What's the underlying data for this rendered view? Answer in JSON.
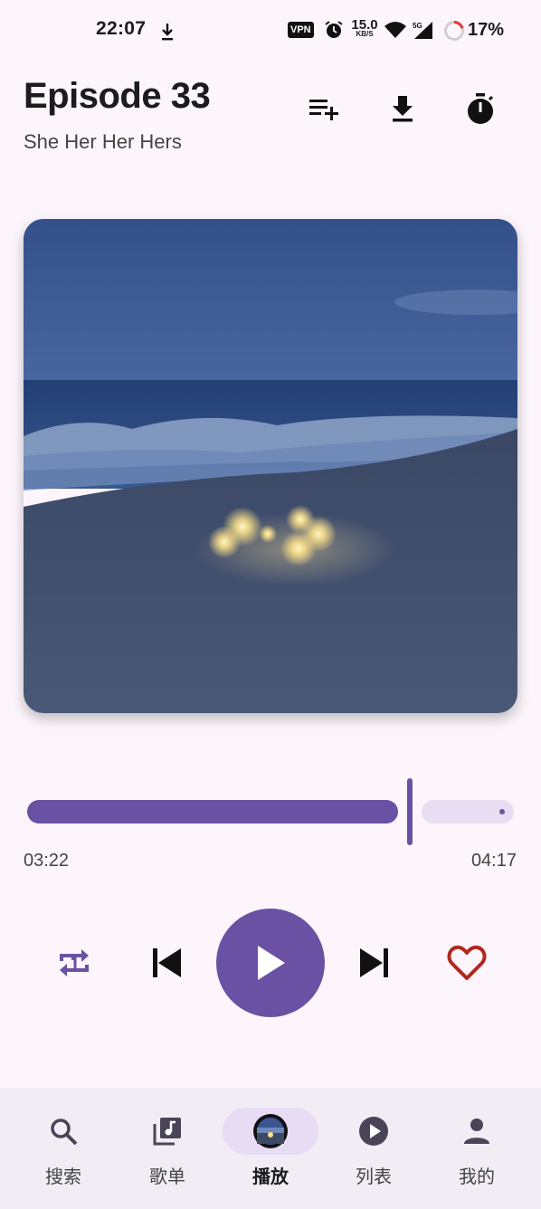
{
  "status_bar": {
    "time": "22:07",
    "vpn": "VPN",
    "net_speed_value": "15.0",
    "net_speed_unit": "KB/S",
    "cell_label": "5G",
    "battery": "17%"
  },
  "header": {
    "title": "Episode 33",
    "subtitle": "She Her Her Hers",
    "icons": [
      "playlist-add-icon",
      "download-icon",
      "timer-icon"
    ]
  },
  "artwork": {
    "description_icon": "album-art",
    "colors": {
      "sky": "#3a5488",
      "sea": "#2f4f86",
      "wave": "#8fa6c8",
      "sand": "#3c4a66",
      "lights": "#ffe9a0"
    }
  },
  "player": {
    "current_time": "03:22",
    "total_time": "04:17",
    "progress": 0.786,
    "liked": false
  },
  "controls": {
    "repeat_icon": "repeat-one-icon",
    "prev_icon": "skip-previous-icon",
    "play_icon": "play-icon",
    "next_icon": "skip-next-icon",
    "like_icon": "heart-outline-icon"
  },
  "bottom_nav": {
    "items": [
      {
        "label": "搜索",
        "icon": "search-icon"
      },
      {
        "label": "歌单",
        "icon": "library-music-icon"
      },
      {
        "label": "播放",
        "icon": "now-playing-thumbnail"
      },
      {
        "label": "列表",
        "icon": "play-circle-icon"
      },
      {
        "label": "我的",
        "icon": "person-icon"
      }
    ],
    "active_index": 2
  },
  "colors": {
    "accent": "#6b51a3",
    "accent_light": "#e7def3",
    "background": "#fcf6fc",
    "nav_bg": "#f2ecf4",
    "heart": "#b3261e"
  }
}
